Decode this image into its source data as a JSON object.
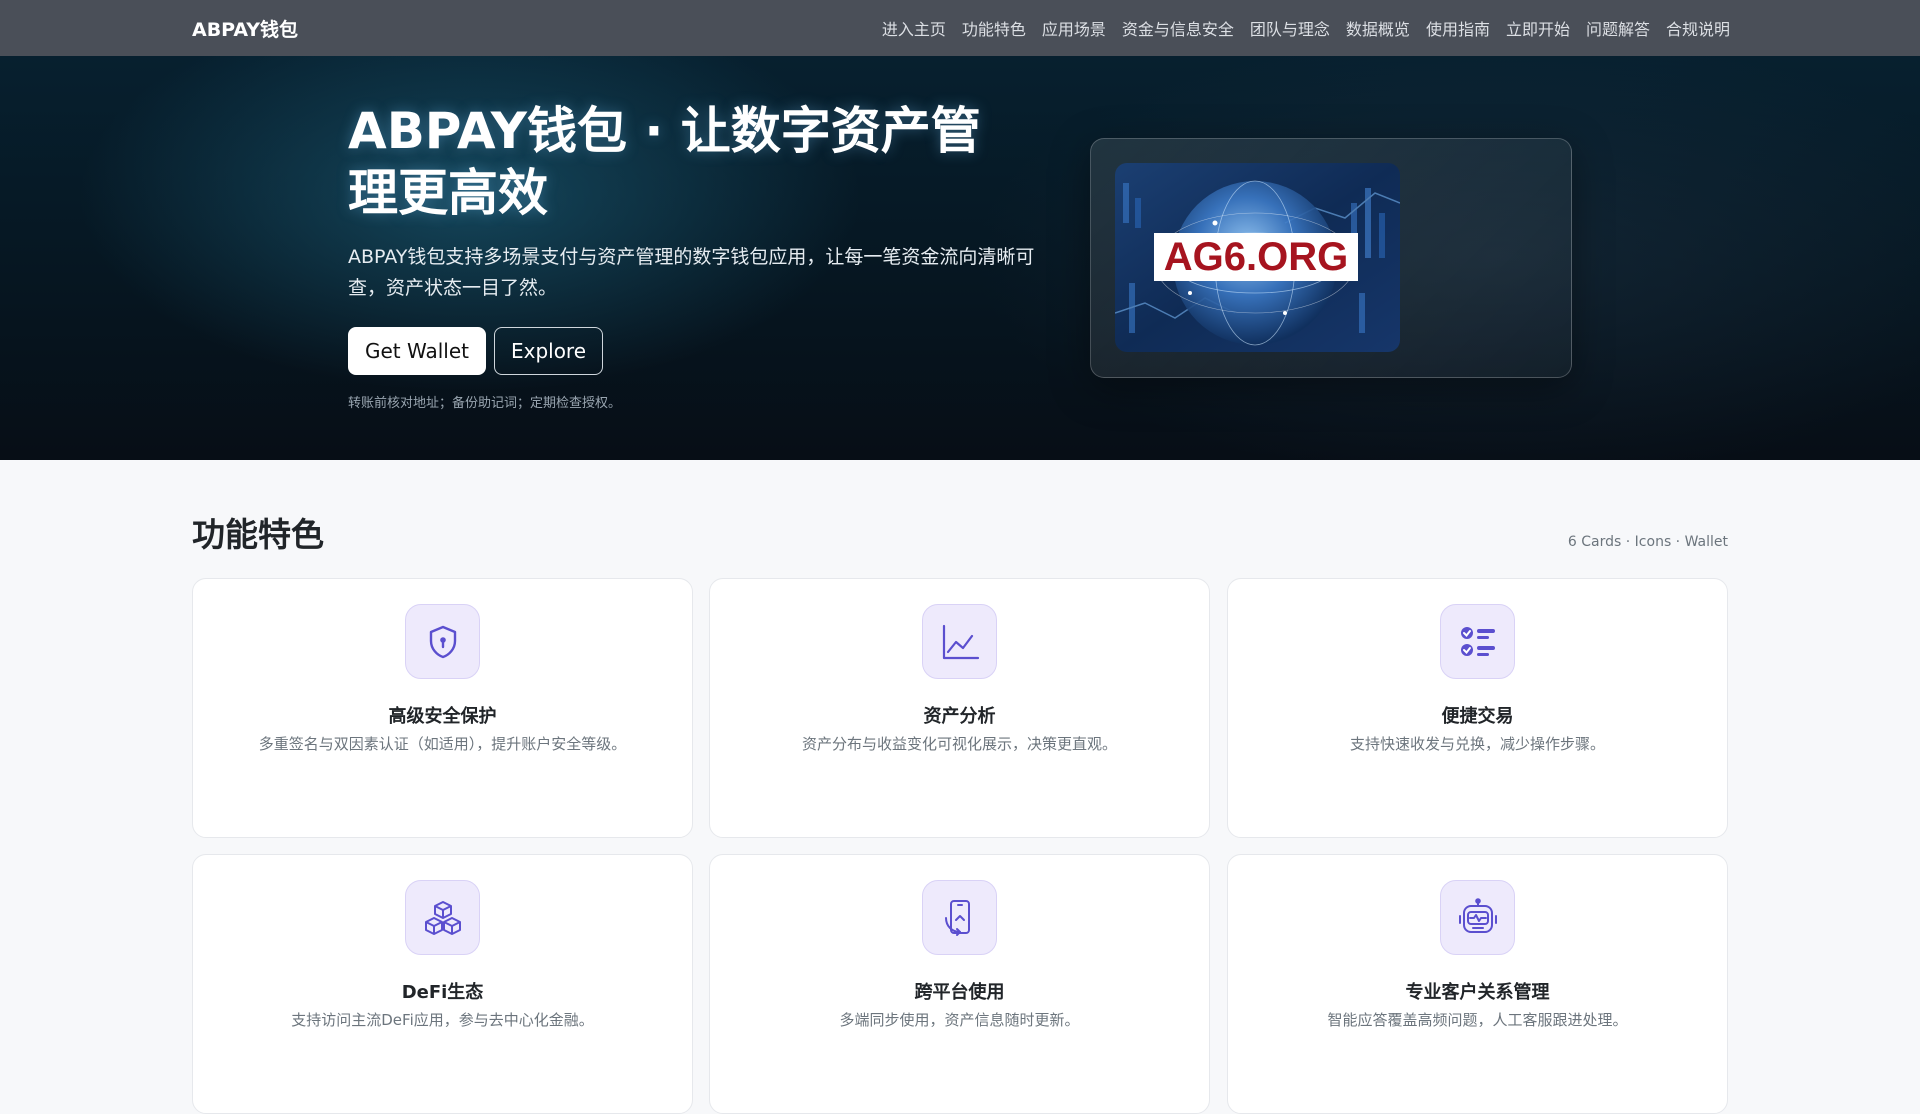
{
  "nav": {
    "brand": "ABPAY钱包",
    "links": [
      "进入主页",
      "功能特色",
      "应用场景",
      "资金与信息安全",
      "团队与理念",
      "数据概览",
      "使用指南",
      "立即开始",
      "问题解答",
      "合规说明"
    ]
  },
  "hero": {
    "title": "ABPAY钱包 · 让数字资产管理更高效",
    "subtitle": "ABPAY钱包支持多场景支付与资产管理的数字钱包应用，让每一笔资金流向清晰可查，资产状态一目了然。",
    "primary_button": "Get Wallet",
    "secondary_button": "Explore",
    "note": "转账前核对地址；备份助记词；定期检查授权。",
    "image_logo_text": "AG6.ORG"
  },
  "features": {
    "title": "功能特色",
    "meta": "6 Cards · Icons · Wallet",
    "cards": [
      {
        "icon": "shield-icon",
        "title": "高级安全保护",
        "desc": "多重签名与双因素认证（如适用），提升账户安全等级。"
      },
      {
        "icon": "chart-line-icon",
        "title": "资产分析",
        "desc": "资产分布与收益变化可视化展示，决策更直观。"
      },
      {
        "icon": "checklist-icon",
        "title": "便捷交易",
        "desc": "支持快速收发与兑换，减少操作步骤。"
      },
      {
        "icon": "boxes-icon",
        "title": "DeFi生态",
        "desc": "支持访问主流DeFi应用，参与去中心化金融。"
      },
      {
        "icon": "phone-sync-icon",
        "title": "跨平台使用",
        "desc": "多端同步使用，资产信息随时更新。"
      },
      {
        "icon": "robot-icon",
        "title": "专业客户关系管理",
        "desc": "智能应答覆盖高频问题，人工客服跟进处理。"
      }
    ]
  },
  "colors": {
    "accent_icon": "#5b4fcf",
    "icon_bg": "#eeeafc",
    "navbar_bg": "#4a4f58",
    "logo_red": "#a6141f"
  }
}
